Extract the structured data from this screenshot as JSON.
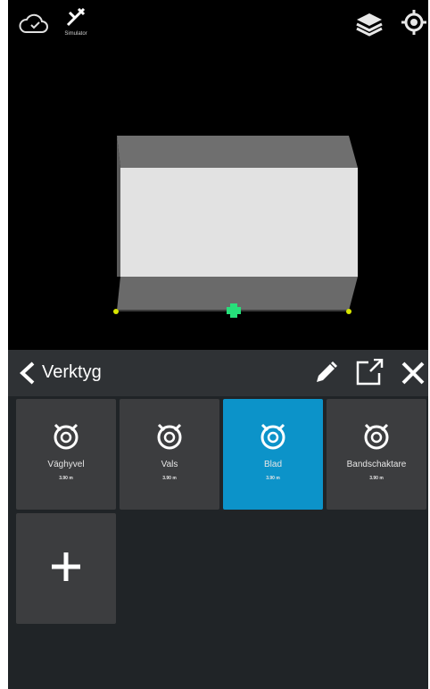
{
  "status_bar": {
    "gps_caption": "Simulator"
  },
  "icons": {
    "cloud": "cloud-icon",
    "gps": "satellite-off-icon",
    "layers": "layers-icon",
    "locate": "locate-icon"
  },
  "tool_panel": {
    "title": "Verktyg",
    "tools": [
      {
        "name": "Väghyvel",
        "size": "3.90 m",
        "selected": false
      },
      {
        "name": "Vals",
        "size": "3.90 m",
        "selected": false
      },
      {
        "name": "Blad",
        "size": "3.90 m",
        "selected": true
      },
      {
        "name": "Bandschaktare",
        "size": "3.90 m",
        "selected": false
      }
    ]
  },
  "colors": {
    "accent": "#0c93c9",
    "tile": "#3c3d3f",
    "panel": "#202427",
    "toolbar": "#2f3235",
    "marker": "#26e07a",
    "corner_marker": "#d8e600"
  }
}
